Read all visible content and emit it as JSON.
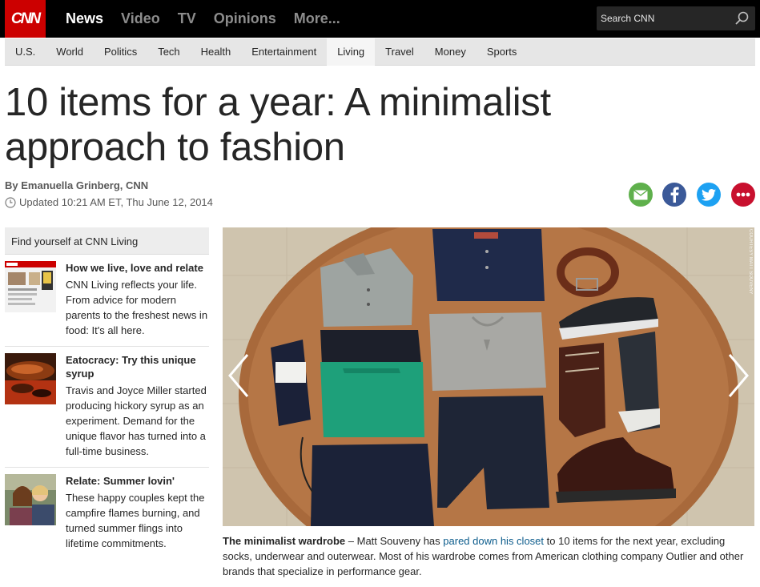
{
  "brand": {
    "logo_text": "CNN",
    "logo_color": "#cc0000"
  },
  "topnav": {
    "items": [
      "News",
      "Video",
      "TV",
      "Opinions",
      "More..."
    ],
    "active": "News"
  },
  "search": {
    "placeholder": "Search CNN"
  },
  "subnav": {
    "items": [
      "U.S.",
      "World",
      "Politics",
      "Tech",
      "Health",
      "Entertainment",
      "Living",
      "Travel",
      "Money",
      "Sports"
    ],
    "active": "Living"
  },
  "article": {
    "headline": "10 items for a year: A minimalist approach to fashion",
    "byline": "By Emanuella Grinberg, CNN",
    "updated": "Updated 10:21 AM ET, Thu June 12, 2014"
  },
  "share": {
    "icons": [
      "email-icon",
      "facebook-icon",
      "twitter-icon",
      "more-icon"
    ]
  },
  "sidebar": {
    "heading": "Find yourself at CNN Living",
    "stories": [
      {
        "title": "How we live, love and relate",
        "desc": "CNN Living reflects your life. From advice for modern parents to the freshest news in food: It's all here."
      },
      {
        "title": "Eatocracy: Try this unique syrup",
        "desc": "Travis and Joyce Miller started producing hickory syrup as an experiment. Demand for the unique flavor has turned into a full-time business."
      },
      {
        "title": "Relate: Summer lovin'",
        "desc": "These happy couples kept the campfire flames burning, and turned summer flings into lifetime commitments."
      }
    ]
  },
  "gallery": {
    "credit": "COURTESY MATT SOUVENY",
    "caption": {
      "lead": "The minimalist wardrobe",
      "before_link": " – Matt Souveny has ",
      "link": "pared down his closet",
      "after_link": " to 10 items for the next year, excluding socks, underwear and outerwear. Most of his wardrobe comes from American clothing company Outlier and other brands that specialize in performance gear."
    }
  }
}
